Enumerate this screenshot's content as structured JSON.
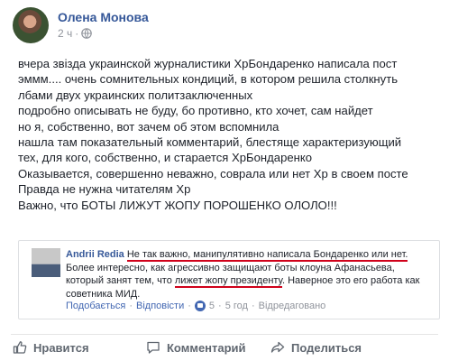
{
  "post": {
    "author": "Олена Монова",
    "time": "2 ч",
    "lines": [
      "вчера звізда украинской журналистики ХрБондаренко написала пост",
      "эммм.... очень сомнительных кондиций, в котором решила столкнуть",
      "лбами двух украинских политзаключенных",
      "подробно описывать не буду, бо противно, кто хочет, сам найдет",
      "но я, собственно, вот зачем об этом вспомнила",
      "нашла там показательный комментарий, блестяще характеризующий",
      "тех, для кого, собственно, и старается ХрБондаренко",
      "Оказывается, совершенно неважно, соврала или нет Хр в своем посте",
      "Правда не нужна читателям Хр",
      "Важно, что БОТЫ ЛИЖУТ ЖОПУ ПОРОШЕНКО ОЛОЛО!!!"
    ]
  },
  "embedded_comment": {
    "author": "Andrii Redia",
    "highlight1": "Не так важно, манипулятивно написала Бондаренко или нет.",
    "text1": "Более интересно, как агрессивно защищают боты клоуна Афанасьева, который занят тем, что ",
    "highlight2": "лижет жопу президенту",
    "text2": ". Наверное это его работа как советника МИД.",
    "actions": {
      "like": "Подобається",
      "reply": "Відповісти",
      "reaction_count": "5",
      "time": "5 год",
      "edited": "Відредаговано",
      "separator": "·"
    }
  },
  "actions": {
    "like": "Нравится",
    "comment": "Комментарий",
    "share": "Поделиться"
  },
  "colors": {
    "link": "#365899",
    "underline": "#d0021b",
    "muted": "#90949c"
  }
}
